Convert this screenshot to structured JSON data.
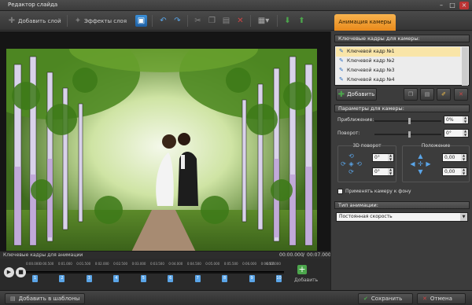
{
  "window": {
    "title": "Редактор слайда"
  },
  "toolbar": {
    "add_layer": "Добавить слой",
    "layer_effects": "Эффекты слоя"
  },
  "tabs": {
    "camera": "Анимация камеры"
  },
  "keyframes": {
    "header": "Ключевые кадры для камеры:",
    "items": [
      "Ключевой кадр №1",
      "Ключевой кадр №2",
      "Ключевой кадр №3",
      "Ключевой кадр №4"
    ],
    "add_button": "Добавить"
  },
  "camera_params": {
    "header": "Параметры для камеры:",
    "zoom_label": "Приближение:",
    "zoom_value": "0%",
    "zoom_slider": 0.5,
    "rotate_label": "Поворот:",
    "rotate_value": "0°",
    "rotate_slider": 0.5,
    "rotation3d_title": "3D поворот",
    "rotation3d_x": "0°",
    "rotation3d_y": "0°",
    "position_title": "Положение",
    "position_x": "0,00",
    "position_y": "0,00",
    "apply_background": "Применять камеру к фону"
  },
  "animation_type": {
    "header": "Тип анимации:",
    "value": "Постоянная скорость"
  },
  "timeline": {
    "label": "Ключевые кадры для анимации",
    "current_time": "00:00.000",
    "total_time": "00:07.000",
    "ruler": [
      "0:00.000",
      "0:00.500",
      "0:01.000",
      "0:01.500",
      "0:02.000",
      "0:02.500",
      "0:03.000",
      "0:03.500",
      "0:04.000",
      "0:04.500",
      "0:05.000",
      "0:05.500",
      "0:06.000",
      "0:06.500",
      "0:07.000"
    ],
    "keys": [
      "1",
      "2",
      "3",
      "4",
      "5",
      "6",
      "7",
      "8",
      "9",
      "10"
    ],
    "add_label": "Добавить"
  },
  "bottom": {
    "add_to_templates": "Добавить в шаблоны",
    "save": "Сохранить",
    "cancel": "Отмена"
  },
  "colors": {
    "accent": "#f39c2b",
    "panel": "#3c3c3c",
    "keyframe": "#5aa5e8"
  }
}
